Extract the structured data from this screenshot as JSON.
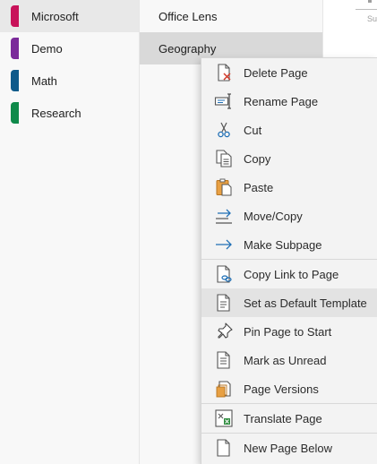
{
  "sections": [
    {
      "label": "Microsoft",
      "color": "#c8125a",
      "selected": true
    },
    {
      "label": "Demo",
      "color": "#7b2a9a",
      "selected": false
    },
    {
      "label": "Math",
      "color": "#0f5a8a",
      "selected": false
    },
    {
      "label": "Research",
      "color": "#0f8a4a",
      "selected": false
    }
  ],
  "pages": [
    {
      "label": "Office Lens",
      "selected": false
    },
    {
      "label": "Geography",
      "selected": true
    }
  ],
  "canvas": {
    "text": "Su"
  },
  "menu": {
    "items": [
      {
        "label": "Delete Page",
        "icon": "delete-page-icon"
      },
      {
        "label": "Rename Page",
        "icon": "rename-page-icon"
      },
      {
        "label": "Cut",
        "icon": "scissors-icon"
      },
      {
        "label": "Copy",
        "icon": "copy-icon"
      },
      {
        "label": "Paste",
        "icon": "paste-icon"
      },
      {
        "label": "Move/Copy",
        "icon": "move-copy-icon"
      },
      {
        "label": "Make Subpage",
        "icon": "arrow-right-icon"
      },
      {
        "label": "Copy Link to Page",
        "icon": "copy-link-icon"
      },
      {
        "label": "Set as Default Template",
        "icon": "template-page-icon"
      },
      {
        "label": "Pin Page to Start",
        "icon": "pin-icon"
      },
      {
        "label": "Mark as Unread",
        "icon": "unread-page-icon"
      },
      {
        "label": "Page Versions",
        "icon": "page-versions-icon"
      },
      {
        "label": "Translate Page",
        "icon": "translate-page-icon"
      },
      {
        "label": "New Page Below",
        "icon": "new-page-icon"
      }
    ]
  }
}
